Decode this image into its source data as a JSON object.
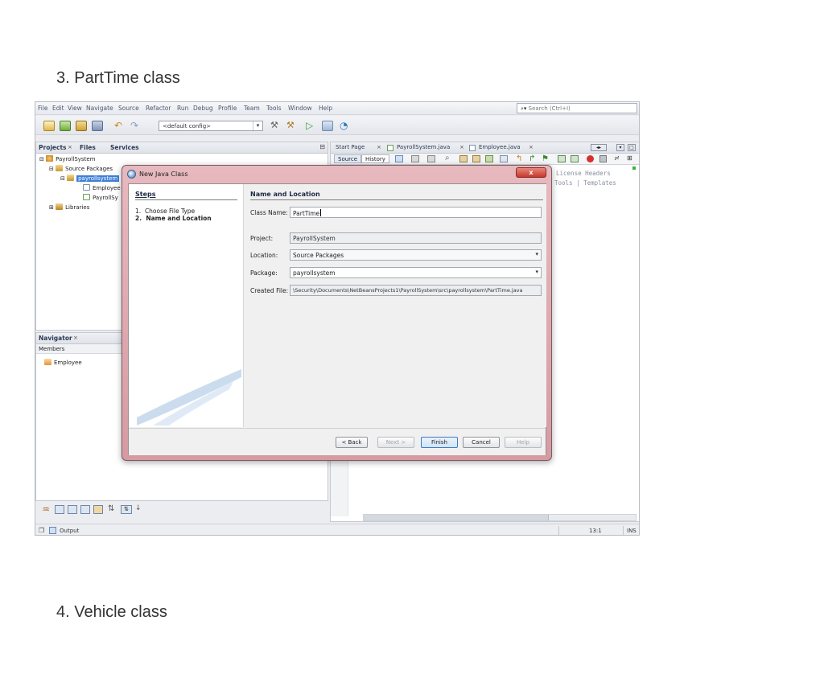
{
  "document": {
    "heading_top": "3. PartTime class",
    "heading_bottom": "4. Vehicle class"
  },
  "ide": {
    "menu": [
      "File",
      "Edit",
      "View",
      "Navigate",
      "Source",
      "Refactor",
      "Run",
      "Debug",
      "Profile",
      "Team",
      "Tools",
      "Window",
      "Help"
    ],
    "search_placeholder": "Search (Ctrl+I)",
    "config": "<default config>",
    "projects_tabs": [
      "Projects",
      "Files",
      "Services"
    ],
    "tree": {
      "project": "PayrollSystem",
      "source_packages": "Source Packages",
      "package": "payrollsystem",
      "file1": "Employee",
      "file2": "PayrollSy",
      "libraries": "Libraries"
    },
    "navigator": {
      "tab": "Navigator",
      "members": "Members",
      "item": "Employee"
    },
    "editor_tabs": [
      "Start Page",
      "PayrollSystem.java",
      "Employee.java"
    ],
    "source_btn": "Source",
    "history_btn": "History",
    "code_line1": "License Headers",
    "code_line2": "Tools | Templates",
    "status": {
      "output": "Output",
      "position": "13:1",
      "mode": "INS"
    }
  },
  "dialog": {
    "title": "New Java Class",
    "close": "x",
    "steps_title": "Steps",
    "steps": [
      {
        "num": "1.",
        "label": "Choose File Type"
      },
      {
        "num": "2.",
        "label": "Name and Location"
      }
    ],
    "section_title": "Name and Location",
    "fields": {
      "class_name_label": "Class Name:",
      "class_name_value": "PartTime",
      "project_label": "Project:",
      "project_value": "PayrollSystem",
      "location_label": "Location:",
      "location_value": "Source Packages",
      "package_label": "Package:",
      "package_value": "payrollsystem",
      "created_file_label": "Created File:",
      "created_file_value": "\\Security\\Documents\\NetBeansProjects1\\PayrollSystem\\src\\payrollsystem\\PartTime.java"
    },
    "buttons": {
      "back": "< Back",
      "next": "Next >",
      "finish": "Finish",
      "cancel": "Cancel",
      "help": "Help"
    }
  },
  "colors": {
    "selection": "#3d7fd6",
    "dialog_frame": "#d69aa2",
    "close_button": "#c7382b"
  }
}
